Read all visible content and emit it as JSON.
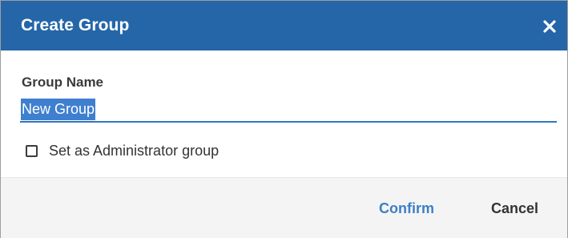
{
  "dialog": {
    "title": "Create Group",
    "close_icon": "close-icon"
  },
  "form": {
    "group_name_label": "Group Name",
    "group_name_value": "New Group",
    "admin_checkbox_label": "Set as Administrator group",
    "admin_checkbox_checked": false
  },
  "footer": {
    "confirm_label": "Confirm",
    "cancel_label": "Cancel"
  },
  "colors": {
    "header_bg": "#2566a8",
    "accent": "#2f76bf",
    "selection": "#3f7fcf",
    "confirm_text": "#3d7fc4"
  }
}
